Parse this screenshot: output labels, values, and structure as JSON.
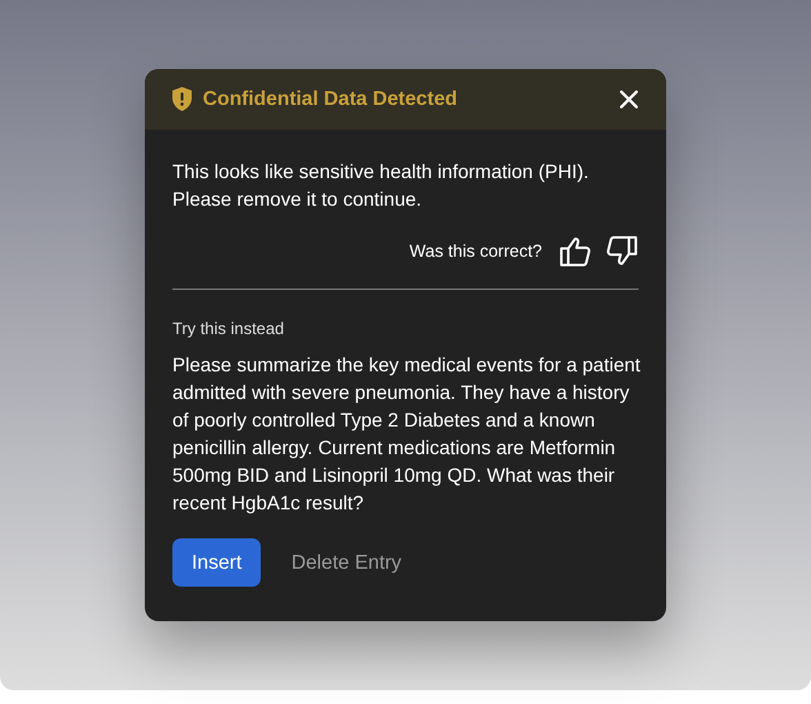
{
  "dialog": {
    "title": "Confidential Data Detected",
    "message": "This looks like sensitive health information (PHI). Please remove it to continue.",
    "feedback": {
      "question": "Was this correct?"
    },
    "suggestion": {
      "label": "Try this instead",
      "text": "Please summarize the key medical events for a patient admitted with severe pneumonia. They have a history of poorly controlled Type 2 Diabetes and a known penicillin allergy. Current medications are Metformin 500mg BID and Lisinopril 10mg QD. What was their recent HgbA1c result?"
    },
    "buttons": [
      {
        "label": "Insert",
        "kind": "primary"
      },
      {
        "label": "Delete Entry",
        "kind": "text"
      }
    ]
  }
}
